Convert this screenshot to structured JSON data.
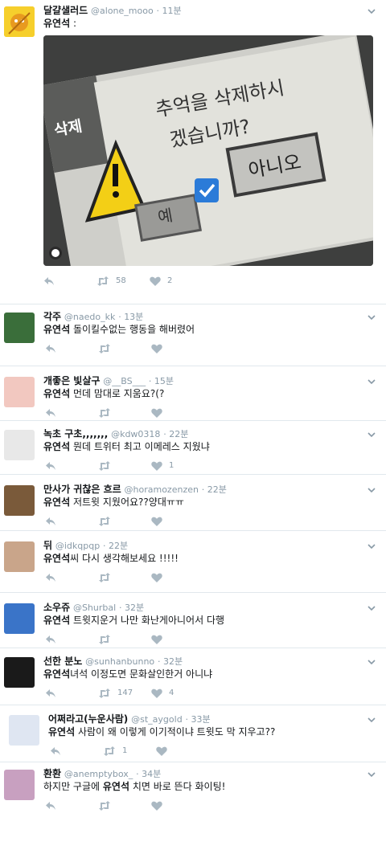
{
  "tweets": [
    {
      "name": "달걀샐러드",
      "handle": "@alone_mooo",
      "time": "11분",
      "mention": "유연석",
      "text": " :",
      "retweets": "58",
      "likes": "2",
      "avatar_color": "#f4c430"
    },
    {
      "name": "각주",
      "handle": "@naedo_kk",
      "time": "13분",
      "mention": "유연석",
      "text": " 돌이킬수없는 행동을 해버렸어",
      "retweets": "",
      "likes": "",
      "avatar_color": "#3a6e3a"
    },
    {
      "name": "개좋은 빛살구",
      "handle": "@__BS___",
      "time": "15분",
      "mention": "유연석",
      "text": " 먼데 맘대로 지움요?(?",
      "retweets": "",
      "likes": "",
      "avatar_color": "#f2c8c0"
    },
    {
      "name": "녹초 구초,,,,,,,",
      "handle": "@kdw0318",
      "time": "22분",
      "mention": "유연석",
      "text": " 뭔데 트위터 최고 이메레스 지웠냐",
      "retweets": "",
      "likes": "1",
      "avatar_color": "#e8e8e8"
    },
    {
      "name": "만사가 귀찮은 흐르",
      "handle": "@horamozenzen",
      "time": "22분",
      "mention": "유연석",
      "text": " 저트윗 지웠어요??양대ㅠㅠ",
      "retweets": "",
      "likes": "",
      "avatar_color": "#7a5a3a"
    },
    {
      "name": "뒤",
      "handle": "@idkqpqp",
      "time": "22분",
      "mention": "유연석",
      "text": "씨 다시 생각해보세요 !!!!!",
      "retweets": "",
      "likes": "",
      "avatar_color": "#c9a58a"
    },
    {
      "name": "소우쥬",
      "handle": "@Shurbal",
      "time": "32분",
      "mention": "유연석",
      "text": " 트윗지운거 나만 화난게아니어서 다행",
      "retweets": "",
      "likes": "",
      "avatar_color": "#3a74c8"
    },
    {
      "name": "선한 분노",
      "handle": "@sunhanbunno",
      "time": "32분",
      "mention": "유연석",
      "text": "녀석 이정도면 문화살인한거 아니냐",
      "retweets": "147",
      "likes": "4",
      "avatar_color": "#1a1a1a"
    },
    {
      "name": "어쩌라고(누운사람)",
      "handle": "@st_aygold",
      "time": "33분",
      "mention": "유연석",
      "text": " 사람이 왜 이렇게 이기적이냐 트윗도 막 지우고??",
      "retweets": "1",
      "likes": "",
      "avatar_color": "#dfe6f2"
    },
    {
      "name": "환환",
      "handle": "@anemptybox_",
      "time": "34분",
      "prefix": "하지만 구글에 ",
      "mention": "유연석",
      "text": " 치면 바로 뜬다 화이팅!",
      "retweets": "",
      "likes": "",
      "avatar_color": "#c8a0c0"
    }
  ],
  "media": {
    "dialog_title": "삭제",
    "dialog_message_line1": "추억을 삭제하시",
    "dialog_message_line2": "겠습니까?",
    "yes_label": "예",
    "no_label": "아니오"
  },
  "colors": {
    "icon": "#aab8c2",
    "meta": "#8899a6",
    "checkbox": "#2b7bd8",
    "divider": "#e1e8ed"
  }
}
